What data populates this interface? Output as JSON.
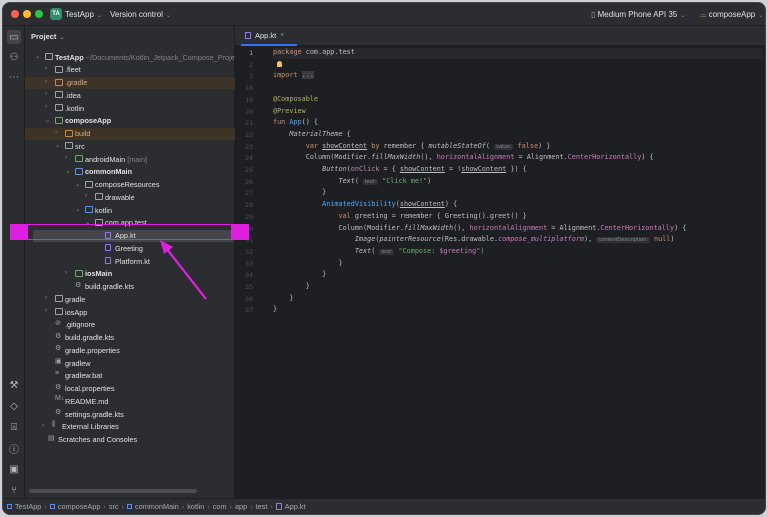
{
  "titlebar": {
    "project_badge": "TA",
    "project": "TestApp",
    "vcs": "Version control",
    "device": "Medium Phone API 35",
    "run_config": "composeApp"
  },
  "project_panel": {
    "title": "Project",
    "items": [
      {
        "label": "TestApp",
        "suffix": " ~/Documents/Kotlin_Jetpack_Compose_Project",
        "level": 0,
        "chev": "open",
        "icon": "",
        "bold": true
      },
      {
        "label": ".fleet",
        "level": 1,
        "chev": "closed",
        "icon": ""
      },
      {
        "label": ".gradle",
        "level": 1,
        "chev": "closed",
        "icon": "orange",
        "hl": true,
        "orange": true
      },
      {
        "label": ".idea",
        "level": 1,
        "chev": "closed",
        "icon": ""
      },
      {
        "label": ".kotlin",
        "level": 1,
        "chev": "closed",
        "icon": ""
      },
      {
        "label": "composeApp",
        "level": 1,
        "chev": "open",
        "icon": "src",
        "bold": true
      },
      {
        "label": "build",
        "level": 2,
        "chev": "closed",
        "icon": "orange",
        "hl": true,
        "orange": true
      },
      {
        "label": "src",
        "level": 2,
        "chev": "open",
        "icon": ""
      },
      {
        "label": "androidMain",
        "suffix": " [main]",
        "level": 3,
        "chev": "closed",
        "icon": "src"
      },
      {
        "label": "commonMain",
        "level": 3,
        "chev": "open",
        "icon": "blue",
        "bold": true
      },
      {
        "label": "composeResources",
        "level": 4,
        "chev": "open",
        "icon": ""
      },
      {
        "label": "drawable",
        "level": 5,
        "chev": "closed",
        "icon": ""
      },
      {
        "label": "kotlin",
        "level": 4,
        "chev": "open",
        "icon": "blue"
      },
      {
        "label": "com.app.test",
        "level": 5,
        "chev": "open",
        "icon": ""
      },
      {
        "label": "App.kt",
        "level": 6,
        "chev": "",
        "icon": "kt",
        "selected": true
      },
      {
        "label": "Greeting",
        "level": 6,
        "chev": "",
        "icon": "kt"
      },
      {
        "label": "Platform.kt",
        "level": 6,
        "chev": "",
        "icon": "kt"
      },
      {
        "label": "iosMain",
        "level": 3,
        "chev": "closed",
        "icon": "src",
        "bold": true
      },
      {
        "label": "build.gradle.kts",
        "level": 3,
        "chev": "",
        "icon": "misc",
        "glyph": "⚙"
      },
      {
        "label": "gradle",
        "level": 1,
        "chev": "closed",
        "icon": ""
      },
      {
        "label": "iosApp",
        "level": 1,
        "chev": "closed",
        "icon": ""
      },
      {
        "label": ".gitignore",
        "level": 1,
        "chev": "",
        "icon": "misc",
        "glyph": "⊘"
      },
      {
        "label": "build.gradle.kts",
        "level": 1,
        "chev": "",
        "icon": "misc",
        "glyph": "⚙"
      },
      {
        "label": "gradle.properties",
        "level": 1,
        "chev": "",
        "icon": "misc",
        "glyph": "⚙"
      },
      {
        "label": "gradlew",
        "level": 1,
        "chev": "",
        "icon": "misc",
        "glyph": "▣"
      },
      {
        "label": "gradlew.bat",
        "level": 1,
        "chev": "",
        "icon": "misc",
        "glyph": "≡"
      },
      {
        "label": "local.properties",
        "level": 1,
        "chev": "",
        "icon": "misc",
        "glyph": "⚙"
      },
      {
        "label": "README.md",
        "level": 1,
        "chev": "",
        "icon": "misc",
        "glyph": "M↓"
      },
      {
        "label": "settings.gradle.kts",
        "level": 1,
        "chev": "",
        "icon": "misc",
        "glyph": "⚙"
      },
      {
        "label": "External Libraries",
        "level": 0.7,
        "chev": "closed",
        "icon": "misc",
        "glyph": "⫼"
      },
      {
        "label": "Scratches and Consoles",
        "level": 0.3,
        "chev": "",
        "icon": "misc",
        "glyph": "▤"
      }
    ]
  },
  "editor": {
    "tab": "App.kt",
    "lines": [
      {
        "n": "1",
        "t": [
          [
            "package",
            "kw"
          ],
          [
            " com.app.test",
            ""
          ]
        ]
      },
      {
        "n": "2",
        "t": []
      },
      {
        "n": "3",
        "t": [
          [
            "import",
            "kw"
          ],
          [
            " ",
            ""
          ],
          [
            "...",
            "fold"
          ]
        ]
      },
      {
        "n": "18",
        "t": []
      },
      {
        "n": "19",
        "t": [
          [
            "@Composable",
            "an"
          ]
        ]
      },
      {
        "n": "20",
        "t": [
          [
            "@Preview",
            "an"
          ]
        ]
      },
      {
        "n": "21",
        "t": [
          [
            "fun",
            "kw"
          ],
          [
            " ",
            ""
          ],
          [
            "App",
            "fn"
          ],
          [
            "() {",
            ""
          ]
        ]
      },
      {
        "n": "22",
        "t": [
          [
            "    ",
            ""
          ],
          [
            "MaterialTheme",
            "it"
          ],
          [
            " {",
            ""
          ]
        ]
      },
      {
        "n": "23",
        "t": [
          [
            "        ",
            ""
          ],
          [
            "var",
            "kw"
          ],
          [
            " ",
            ""
          ],
          [
            "showContent",
            "ul"
          ],
          [
            " ",
            ""
          ],
          [
            "by",
            "kw"
          ],
          [
            " remember { ",
            ""
          ],
          [
            "mutableStateOf",
            "it"
          ],
          [
            "( ",
            ""
          ],
          [
            "value:",
            "hint"
          ],
          [
            " ",
            ""
          ],
          [
            "false",
            "kw"
          ],
          [
            ") }",
            ""
          ]
        ]
      },
      {
        "n": "24",
        "t": [
          [
            "        Column(Modifier.",
            ""
          ],
          [
            "fillMaxWidth",
            "it"
          ],
          [
            "(), ",
            ""
          ],
          [
            "horizontalAlignment",
            "pr"
          ],
          [
            " = Alignment.",
            ""
          ],
          [
            "CenterHorizontally",
            "pr"
          ],
          [
            ") {",
            ""
          ]
        ]
      },
      {
        "n": "25",
        "t": [
          [
            "            ",
            ""
          ],
          [
            "Button",
            "it"
          ],
          [
            "(",
            ""
          ],
          [
            "onClick",
            "pr"
          ],
          [
            " = { ",
            ""
          ],
          [
            "showContent",
            "ul"
          ],
          [
            " = !",
            ""
          ],
          [
            "showContent",
            "ul"
          ],
          [
            " }) {",
            ""
          ]
        ]
      },
      {
        "n": "26",
        "t": [
          [
            "                ",
            ""
          ],
          [
            "Text",
            "it"
          ],
          [
            "( ",
            ""
          ],
          [
            "text:",
            "hint"
          ],
          [
            " ",
            ""
          ],
          [
            "\"Click me!\"",
            "st"
          ],
          [
            ")",
            ""
          ]
        ]
      },
      {
        "n": "27",
        "t": [
          [
            "            }",
            ""
          ]
        ]
      },
      {
        "n": "28",
        "t": [
          [
            "            ",
            ""
          ],
          [
            "AnimatedVisibility",
            "fn"
          ],
          [
            "(",
            ""
          ],
          [
            "showContent",
            "ul"
          ],
          [
            ") {",
            ""
          ]
        ]
      },
      {
        "n": "29",
        "t": [
          [
            "                ",
            ""
          ],
          [
            "val",
            "kw"
          ],
          [
            " greeting = remember { Greeting().greet() }",
            ""
          ]
        ]
      },
      {
        "n": "30",
        "t": [
          [
            "                Column(Modifier.",
            ""
          ],
          [
            "fillMaxWidth",
            "it"
          ],
          [
            "(), ",
            ""
          ],
          [
            "horizontalAlignment",
            "pr"
          ],
          [
            " = Alignment.",
            ""
          ],
          [
            "CenterHorizontally",
            "pr"
          ],
          [
            ") {",
            ""
          ]
        ]
      },
      {
        "n": "31",
        "t": [
          [
            "                    ",
            ""
          ],
          [
            "Image",
            "it"
          ],
          [
            "(",
            ""
          ],
          [
            "painterResource",
            "it"
          ],
          [
            "(Res.drawable.",
            ""
          ],
          [
            "compose_multiplatform",
            "pi"
          ],
          [
            "), ",
            ""
          ],
          [
            "contentDescription:",
            "hint"
          ],
          [
            " ",
            ""
          ],
          [
            "null",
            "kw"
          ],
          [
            ")",
            ""
          ]
        ]
      },
      {
        "n": "32",
        "t": [
          [
            "                    ",
            ""
          ],
          [
            "Text",
            "it"
          ],
          [
            "( ",
            ""
          ],
          [
            "text:",
            "hint"
          ],
          [
            " ",
            ""
          ],
          [
            "\"Compose: ",
            "st"
          ],
          [
            "$greeting",
            "pr"
          ],
          [
            "\")",
            "st"
          ]
        ]
      },
      {
        "n": "33",
        "t": [
          [
            "                }",
            ""
          ]
        ]
      },
      {
        "n": "34",
        "t": [
          [
            "            }",
            ""
          ]
        ]
      },
      {
        "n": "35",
        "t": [
          [
            "        }",
            ""
          ]
        ]
      },
      {
        "n": "36",
        "t": [
          [
            "    }",
            ""
          ]
        ]
      },
      {
        "n": "37",
        "t": [
          [
            "}",
            ""
          ]
        ]
      }
    ]
  },
  "breadcrumb": [
    "TestApp",
    "composeApp",
    "src",
    "commonMain",
    "kotlin",
    "com",
    "app",
    "test",
    "App.kt"
  ],
  "colors": {
    "accent": "#3574f0",
    "annotation_highlight": "#e020e0",
    "editor_bg": "#1e1f22",
    "panel_bg": "#2b2d30"
  }
}
